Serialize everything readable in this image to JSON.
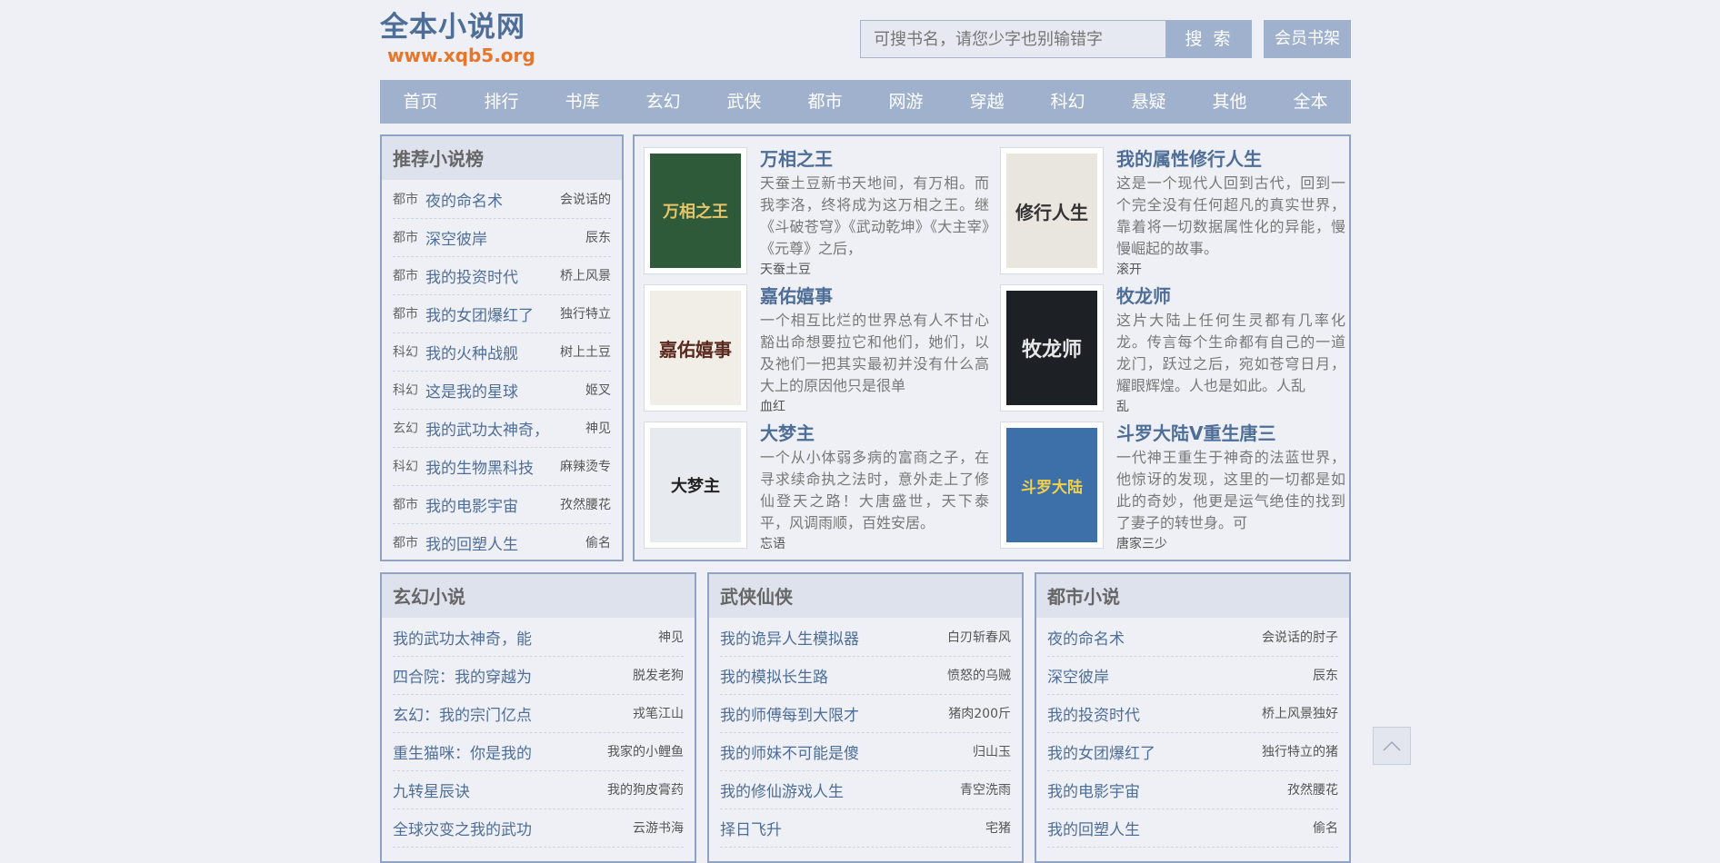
{
  "site": {
    "title": "全本小说网",
    "url": "www.xqb5.org"
  },
  "search": {
    "placeholder": "可搜书名，请您少字也别输错字",
    "button": "搜 索"
  },
  "shelf_button": "会员书架",
  "nav": [
    "首页",
    "排行",
    "书库",
    "玄幻",
    "武侠",
    "都市",
    "网游",
    "穿越",
    "科幻",
    "悬疑",
    "其他",
    "全本"
  ],
  "recommend": {
    "title": "推荐小说榜",
    "items": [
      {
        "cat": "都市",
        "title": "夜的命名术",
        "author": "会说话的"
      },
      {
        "cat": "都市",
        "title": "深空彼岸",
        "author": "辰东"
      },
      {
        "cat": "都市",
        "title": "我的投资时代",
        "author": "桥上风景"
      },
      {
        "cat": "都市",
        "title": "我的女团爆红了",
        "author": "独行特立"
      },
      {
        "cat": "科幻",
        "title": "我的火种战舰",
        "author": "树上土豆"
      },
      {
        "cat": "科幻",
        "title": "这是我的星球",
        "author": "姬叉"
      },
      {
        "cat": "玄幻",
        "title": "我的武功太神奇，",
        "author": "神见"
      },
      {
        "cat": "科幻",
        "title": "我的生物黑科技",
        "author": "麻辣烫专"
      },
      {
        "cat": "都市",
        "title": "我的电影宇宙",
        "author": "孜然腰花"
      },
      {
        "cat": "都市",
        "title": "我的回塑人生",
        "author": "偷名"
      }
    ]
  },
  "featured": [
    {
      "title": "万相之王",
      "desc": "天蚕土豆新书天地间，有万相。而我李洛，终将成为这万相之王。继《斗破苍穹》《武动乾坤》《大主宰》《元尊》之后，",
      "author": "天蚕土豆",
      "cover": "万相之王"
    },
    {
      "title": "我的属性修行人生",
      "desc": "这是一个现代人回到古代，回到一个完全没有任何超凡的真实世界，靠着将一切数据属性化的异能，慢慢崛起的故事。",
      "author": "滚开",
      "cover": "修行人生"
    },
    {
      "title": "嘉佑嬉事",
      "desc": "一个相互比烂的世界总有人不甘心豁出命想要拉它和他们，她们，以及祂们一把其实最初并没有什么高大上的原因他只是很单",
      "author": "血红",
      "cover": "嘉佑嬉事"
    },
    {
      "title": "牧龙师",
      "desc": "这片大陆上任何生灵都有几率化龙。传言每个生命都有自己的一道龙门，跃过之后，宛如苍穹日月，耀眼辉煌。人也是如此。人乱",
      "author": "乱",
      "cover": "牧龙师"
    },
    {
      "title": "大梦主",
      "desc": "一个从小体弱多病的富商之子，在寻求续命执之法时，意外走上了修仙登天之路！大唐盛世，天下泰平，风调雨顺，百姓安居。",
      "author": "忘语",
      "cover": "大梦主"
    },
    {
      "title": "斗罗大陆V重生唐三",
      "desc": "一代神王重生于神奇的法蓝世界，他惊讶的发现，这里的一切都是如此的奇妙，他更是运气绝佳的找到了妻子的转世身。可",
      "author": "唐家三少",
      "cover": "斗罗大陆"
    }
  ],
  "categories": [
    {
      "title": "玄幻小说",
      "items": [
        {
          "title": "我的武功太神奇，能",
          "author": "神见"
        },
        {
          "title": "四合院：我的穿越为",
          "author": "脱发老狗"
        },
        {
          "title": "玄幻：我的宗门亿点",
          "author": "戎笔江山"
        },
        {
          "title": "重生猫咪：你是我的",
          "author": "我家的小鲤鱼"
        },
        {
          "title": "九转星辰诀",
          "author": "我的狗皮膏药"
        },
        {
          "title": "全球灾变之我的武功",
          "author": "云游书海"
        }
      ]
    },
    {
      "title": "武侠仙侠",
      "items": [
        {
          "title": "我的诡异人生模拟器",
          "author": "白刃斩春风"
        },
        {
          "title": "我的模拟长生路",
          "author": "愤怒的乌贼"
        },
        {
          "title": "我的师傅每到大限才",
          "author": "猪肉200斤"
        },
        {
          "title": "我的师妹不可能是傻",
          "author": "归山玉"
        },
        {
          "title": "我的修仙游戏人生",
          "author": "青空洗雨"
        },
        {
          "title": "择日飞升",
          "author": "宅猪"
        }
      ]
    },
    {
      "title": "都市小说",
      "items": [
        {
          "title": "夜的命名术",
          "author": "会说话的肘子"
        },
        {
          "title": "深空彼岸",
          "author": "辰东"
        },
        {
          "title": "我的投资时代",
          "author": "桥上风景独好"
        },
        {
          "title": "我的女团爆红了",
          "author": "独行特立的猪"
        },
        {
          "title": "我的电影宇宙",
          "author": "孜然腰花"
        },
        {
          "title": "我的回塑人生",
          "author": "偷名"
        }
      ]
    }
  ],
  "colors": {
    "accent": "#4f6e97",
    "nav_bg": "#9fb1cd",
    "url": "#e8762a",
    "page_bg": "#eef0f6"
  },
  "icons": {
    "back_to_top": "chevron-up-icon"
  }
}
